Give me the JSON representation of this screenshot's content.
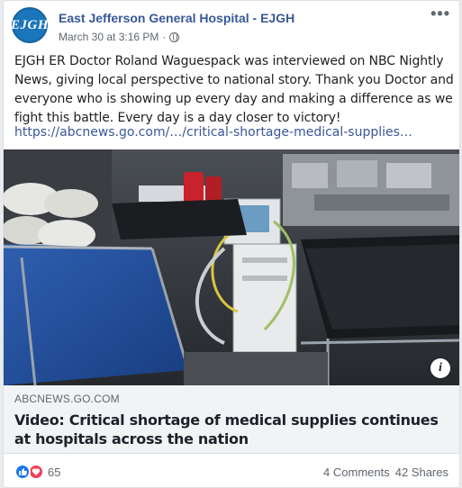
{
  "post": {
    "page_name": "East Jefferson General Hospital - EJGH",
    "avatar_text": "EJGH",
    "timestamp": "March 30 at 3:16 PM",
    "separator": "·",
    "more_glyph": "•••",
    "privacy_icon": "globe-icon",
    "text": "EJGH ER Doctor Roland Waguespack was interviewed on NBC Nightly News, giving local perspective to national story. Thank you Doctor and everyone who is showing up every day and making a difference as we fight this battle. Every day is a day closer to victory!",
    "link_text": "https://abcnews.go.com/…/critical-shortage-medical-supplies…"
  },
  "preview": {
    "domain": "ABCNEWS.GO.COM",
    "title": "Video: Critical shortage of medical supplies continues at hospitals across the nation",
    "info_glyph": "i"
  },
  "footer": {
    "reaction_count": "65",
    "comments": "4 Comments",
    "shares": "42 Shares"
  },
  "colors": {
    "link": "#385898",
    "avatar": "#1a75bb",
    "like": "#1877f2",
    "love": "#f33e58"
  }
}
